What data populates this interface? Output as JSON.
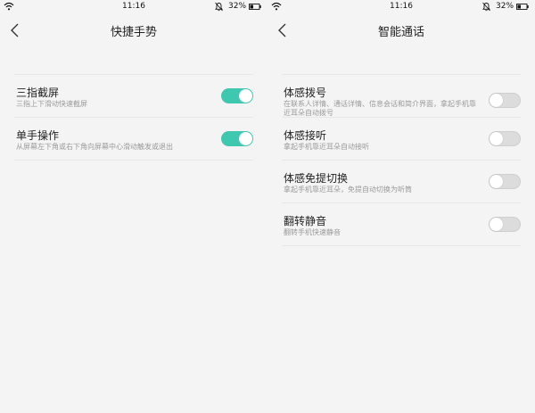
{
  "status_bar": {
    "time": "11:16",
    "battery": "32%"
  },
  "colors": {
    "accent": "#3ec8b0",
    "background": "#f4f4f4",
    "toggle_off": "#dcdcdc"
  },
  "left_screen": {
    "title": "快捷手势",
    "items": [
      {
        "name": "三指截屏",
        "desc": "三指上下滑动快速截屏",
        "enabled": true
      },
      {
        "name": "单手操作",
        "desc": "从屏幕左下角或右下角向屏幕中心滑动触发或退出",
        "enabled": true
      }
    ]
  },
  "right_screen": {
    "title": "智能通话",
    "items": [
      {
        "name": "体感拨号",
        "desc": "在联系人详情、通话详情、信息会话和简介界面，拿起手机靠近耳朵自动拨号",
        "enabled": false
      },
      {
        "name": "体感接听",
        "desc": "拿起手机靠近耳朵自动接听",
        "enabled": false
      },
      {
        "name": "体感免提切换",
        "desc": "拿起手机靠近耳朵，免提自动切换为听筒",
        "enabled": false
      },
      {
        "name": "翻转静音",
        "desc": "翻转手机快速静音",
        "enabled": false
      }
    ]
  }
}
